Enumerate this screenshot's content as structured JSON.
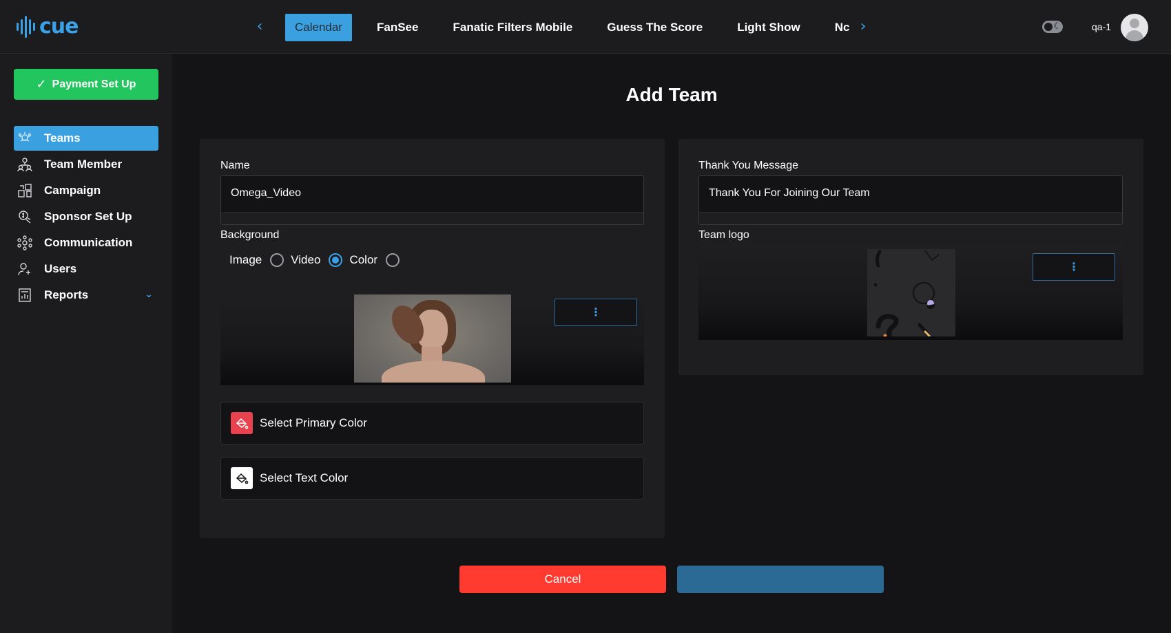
{
  "app": {
    "logo_text": "cue"
  },
  "topnav": {
    "tabs": [
      {
        "label": "Calendar",
        "active": true
      },
      {
        "label": "FanSee",
        "active": false
      },
      {
        "label": "Fanatic Filters Mobile",
        "active": false
      },
      {
        "label": "Guess The Score",
        "active": false
      },
      {
        "label": "Light Show",
        "active": false
      },
      {
        "label": "Nc",
        "active": false
      }
    ],
    "prev_icon": "chevron-left-icon",
    "next_icon": "chevron-right-icon",
    "username": "qa-1"
  },
  "sidebar": {
    "payment_button": "Payment Set Up",
    "items": [
      {
        "label": "Teams",
        "icon": "teams-icon",
        "active": true
      },
      {
        "label": "Team Member",
        "icon": "team-member-icon",
        "active": false
      },
      {
        "label": "Campaign",
        "icon": "campaign-icon",
        "active": false
      },
      {
        "label": "Sponsor Set Up",
        "icon": "sponsor-icon",
        "active": false
      },
      {
        "label": "Communication",
        "icon": "communication-icon",
        "active": false
      },
      {
        "label": "Users",
        "icon": "users-icon",
        "active": false
      },
      {
        "label": "Reports",
        "icon": "reports-icon",
        "active": false,
        "expandable": true
      }
    ]
  },
  "page": {
    "title": "Add Team",
    "left": {
      "name_label": "Name",
      "name_value": "Omega_Video",
      "background_label": "Background",
      "background_options": [
        {
          "label": "Image",
          "selected": false
        },
        {
          "label": "Video",
          "selected": true
        },
        {
          "label": "Color",
          "selected": false
        }
      ],
      "primary_color_label": "Select Primary Color",
      "text_color_label": "Select Text Color",
      "more_label": "⋮"
    },
    "right": {
      "thank_you_label": "Thank You Message",
      "thank_you_value": "Thank You For Joining Our Team",
      "logo_label": "Team logo",
      "more_label": "⋮"
    },
    "actions": {
      "cancel": "Cancel",
      "submit": ""
    }
  },
  "colors": {
    "accent": "#3aa0e0",
    "success": "#22c55e",
    "danger": "#ff3b30",
    "primary_swatch": "#e8424e",
    "text_swatch": "#ffffff"
  }
}
